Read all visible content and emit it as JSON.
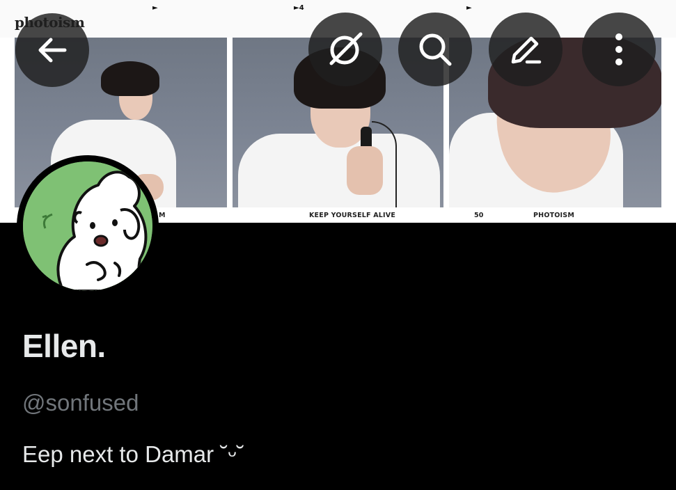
{
  "banner": {
    "brand": "photoism",
    "frame_marks": [
      "►",
      "►4",
      "►"
    ],
    "captions": {
      "left": "M",
      "middle": "KEEP YOURSELF ALIVE",
      "number": "50",
      "right": "PHOTOISM"
    },
    "colors": {
      "backdrop": "#7c8493",
      "shirt": "#f4f4f4",
      "hair": "#1c1716"
    }
  },
  "toolbar": {
    "back_icon": "arrow-left-icon",
    "grok_icon": "grok-icon",
    "search_icon": "search-icon",
    "edit_icon": "edit-pencil-icon",
    "more_icon": "more-vertical-icon"
  },
  "profile": {
    "avatar_icon": "white-puppy-avatar",
    "avatar_bg": "#7fc174",
    "display_name": "Ellen.",
    "handle": "@sonfused",
    "bio": "Eep next to Damar ˘ᵕ˘"
  },
  "colors": {
    "background": "#000000",
    "primary_text": "#e7e9ea",
    "secondary_text": "#71767b",
    "button_bg": "#1e1e1e"
  }
}
